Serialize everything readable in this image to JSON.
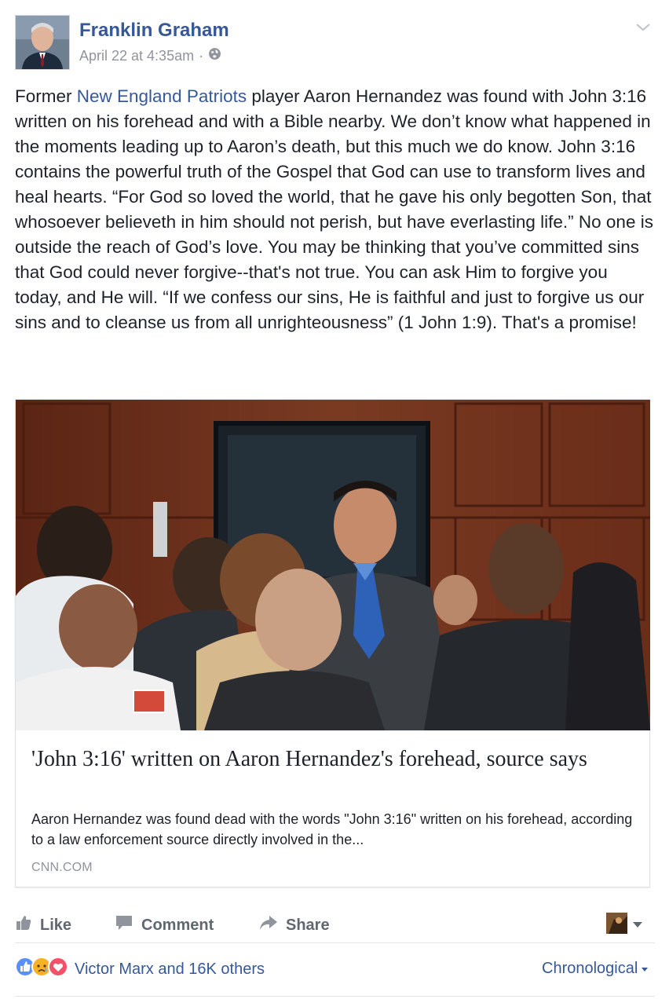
{
  "post": {
    "author": "Franklin Graham",
    "timestamp": "April 22 at 4:35am",
    "meta_separator": "·",
    "privacy_icon": "globe-icon",
    "text_before_link": "Former ",
    "text_link": "New England Patriots",
    "text_after_link": " player Aaron Hernandez was found with John 3:16 written on his forehead and with a Bible nearby. We don’t know what happened in the moments leading up to Aaron’s death, but this much we do know. John 3:16 contains the powerful truth of the Gospel that God can use to transform lives and heal hearts. “For God so loved the world, that he gave his only begotten Son, that whosoever believeth in him should not perish, but have everlasting life.” No one is outside the reach of God’s love. You may be thinking that you’ve committed sins that God could never forgive--that's not true. You can ask Him to forgive you today, and He will. “If we confess our sins, He is faithful and just to forgive us our sins and to cleanse us from all unrighteousness” (1 John 1:9). That's a promise!"
  },
  "link_card": {
    "title": "'John 3:16' written on Aaron Hernandez's forehead, source says",
    "description": "Aaron Hernandez was found dead with the words \"John 3:16\" written on his forehead, according to a law enforcement source directly involved in the...",
    "domain": "CNN.COM"
  },
  "actions": {
    "like": "Like",
    "comment": "Comment",
    "share": "Share"
  },
  "reactions": {
    "summary": "Victor Marx and 16K others",
    "icons": [
      "like-icon",
      "sad-icon",
      "love-icon"
    ],
    "order_label": "Chronological"
  },
  "colors": {
    "link_blue": "#365899",
    "meta_gray": "#90949c",
    "action_gray": "#606770",
    "like_blue": "#5890ff",
    "love_red": "#f25268",
    "sad_yellow": "#f7b125"
  }
}
